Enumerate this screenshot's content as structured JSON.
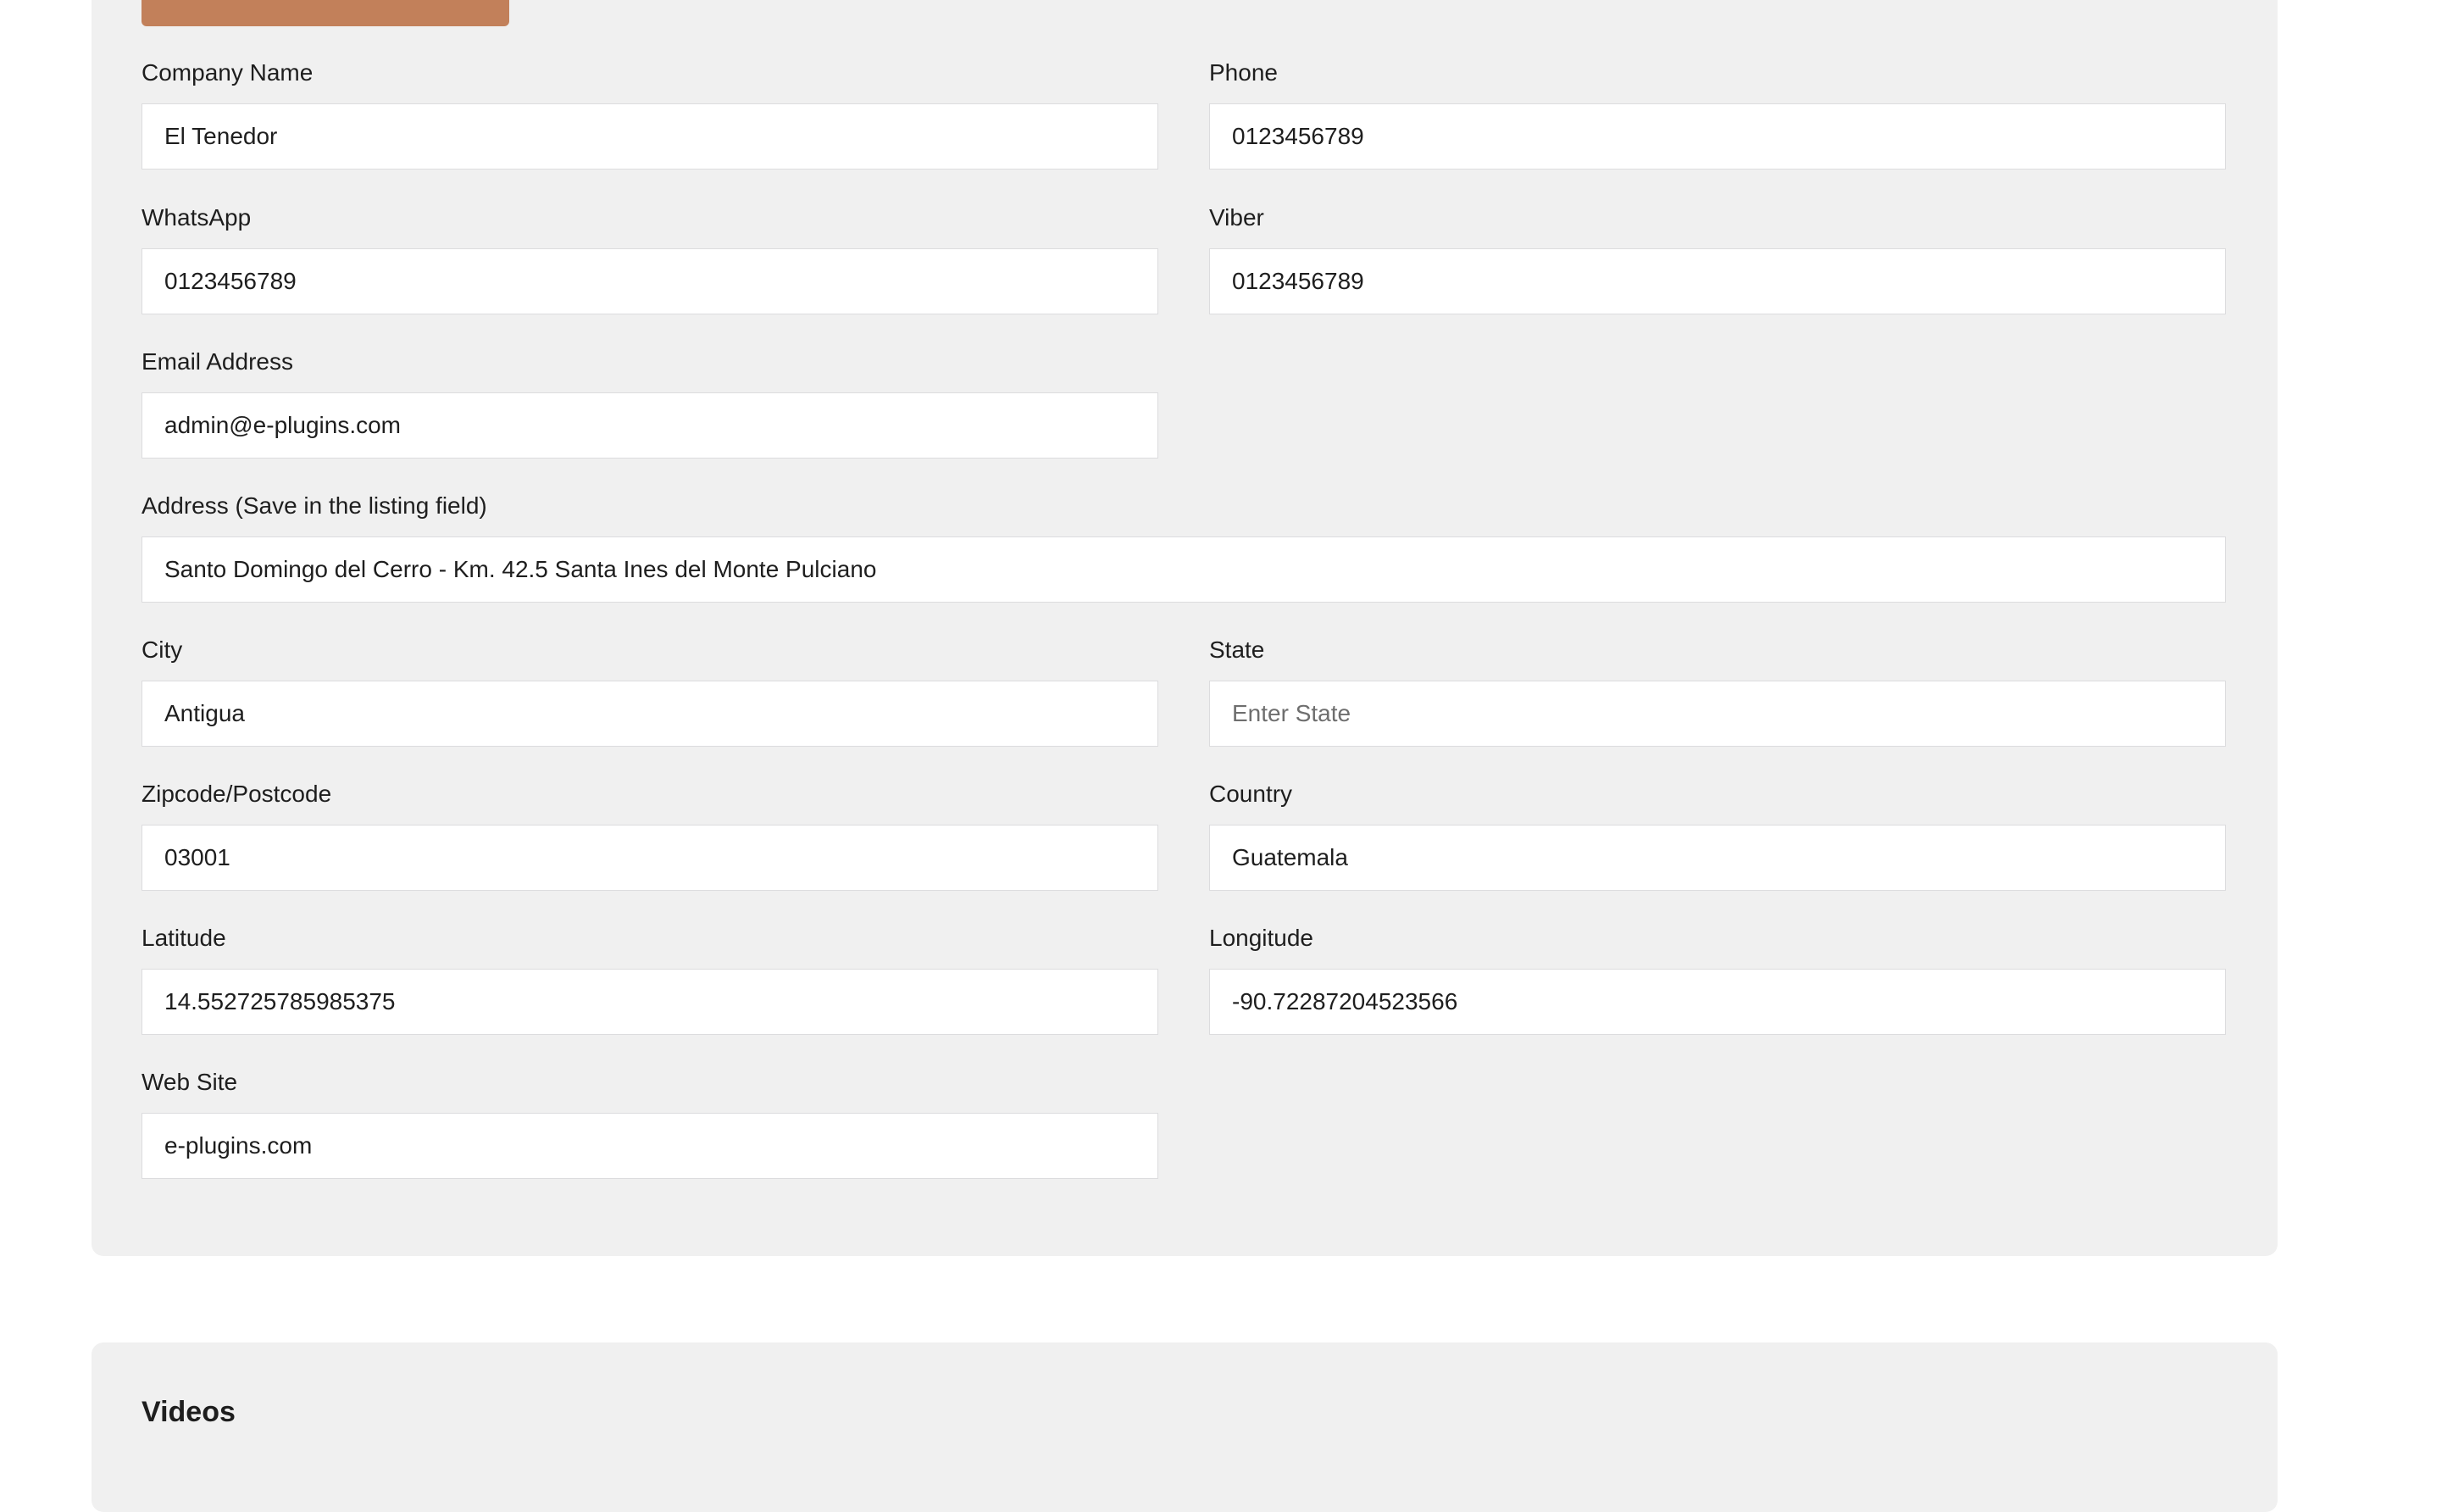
{
  "form": {
    "company_name": {
      "label": "Company Name",
      "value": "El Tenedor"
    },
    "phone": {
      "label": "Phone",
      "value": "0123456789"
    },
    "whatsapp": {
      "label": "WhatsApp",
      "value": "0123456789"
    },
    "viber": {
      "label": "Viber",
      "value": "0123456789"
    },
    "email": {
      "label": "Email Address",
      "value": "admin@e-plugins.com"
    },
    "address": {
      "label": "Address (Save in the listing field)",
      "value": "Santo Domingo del Cerro - Km. 42.5 Santa Ines del Monte Pulciano"
    },
    "city": {
      "label": "City",
      "value": "Antigua"
    },
    "state": {
      "label": "State",
      "value": "",
      "placeholder": "Enter State"
    },
    "zipcode": {
      "label": "Zipcode/Postcode",
      "value": "03001"
    },
    "country": {
      "label": "Country",
      "value": "Guatemala"
    },
    "latitude": {
      "label": "Latitude",
      "value": "14.552725785985375"
    },
    "longitude": {
      "label": "Longitude",
      "value": "-90.72287204523566"
    },
    "website": {
      "label": "Web Site",
      "value": "e-plugins.com"
    }
  },
  "videos_section": {
    "heading": "Videos"
  },
  "colors": {
    "accent_button": "#c2805a",
    "panel_background": "#f0f0f0",
    "input_border": "#dcdcde"
  }
}
